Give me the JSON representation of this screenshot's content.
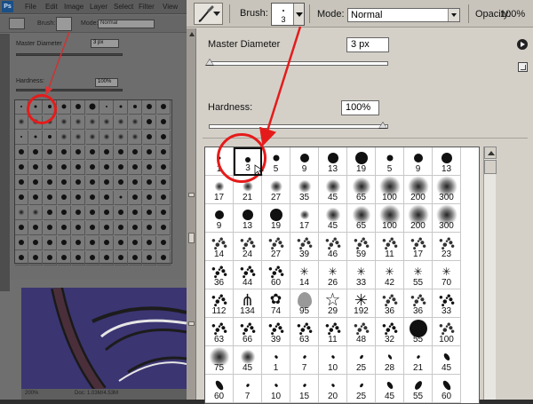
{
  "thumbnail": {
    "menu": [
      "File",
      "Edit",
      "Image",
      "Layer",
      "Select",
      "Filter",
      "View"
    ],
    "ps_logo": "Ps",
    "options": {
      "brush_label": "Brush:",
      "mode_label": "Mode:",
      "mode_value": "Normal"
    },
    "panel": {
      "diameter_label": "Master Diameter",
      "diameter_value": "3 px",
      "hardness_label": "Hardness:",
      "hardness_value": "100%"
    },
    "status": {
      "zoom": "200%",
      "doc": "Doc: 1.03M/4.53M"
    }
  },
  "toolbar": {
    "brush_label": "Brush:",
    "brush_size": "3",
    "mode_label": "Mode:",
    "mode_value": "Normal",
    "opacity_label": "Opacity:",
    "opacity_value": "100%"
  },
  "panel": {
    "diameter_label": "Master Diameter",
    "diameter_value": "3 px",
    "hardness_label": "Hardness:",
    "hardness_value": "100%"
  },
  "colors": {
    "highlight": "#e51b1b",
    "panel_bg": "#d4d0c8"
  },
  "brush_rows": [
    [
      "1",
      "3",
      "5",
      "9",
      "13",
      "19",
      "5",
      "9",
      "13"
    ],
    [
      "17",
      "21",
      "27",
      "35",
      "45",
      "65",
      "100",
      "200",
      "300"
    ],
    [
      "9",
      "13",
      "19",
      "17",
      "45",
      "65",
      "100",
      "200",
      "300"
    ],
    [
      "14",
      "24",
      "27",
      "39",
      "46",
      "59",
      "11",
      "17",
      "23"
    ],
    [
      "36",
      "44",
      "60",
      "14",
      "26",
      "33",
      "42",
      "55",
      "70"
    ],
    [
      "112",
      "134",
      "74",
      "95",
      "29",
      "192",
      "36",
      "36",
      "33"
    ],
    [
      "63",
      "66",
      "39",
      "63",
      "11",
      "48",
      "32",
      "55",
      "100"
    ],
    [
      "75",
      "45",
      "1",
      "7",
      "10",
      "25",
      "28",
      "21",
      "45"
    ],
    [
      "60",
      "7",
      "10",
      "15",
      "20",
      "25",
      "45",
      "55",
      "60"
    ]
  ],
  "brush_types": [
    [
      "hard",
      "hard",
      "hard",
      "hard",
      "hard",
      "hard",
      "hard",
      "hard",
      "hard"
    ],
    [
      "soft",
      "soft",
      "soft",
      "soft",
      "soft",
      "soft",
      "soft",
      "soft",
      "soft"
    ],
    [
      "hard",
      "hard",
      "hard",
      "soft",
      "soft",
      "soft",
      "soft",
      "soft",
      "soft"
    ],
    [
      "spatter",
      "spatter",
      "spatter",
      "spatter",
      "spatter",
      "spatter",
      "spatter",
      "spatter",
      "spatter"
    ],
    [
      "chalk",
      "chalk",
      "chalk",
      "star",
      "star",
      "star",
      "star",
      "star",
      "star"
    ],
    [
      "dune",
      "grass",
      "leaf",
      "leaf-gray",
      "star-outline",
      "burst",
      "spatter",
      "spatter",
      "chalk"
    ],
    [
      "chalk",
      "chalk",
      "chalk",
      "chalk",
      "dune",
      "spatter",
      "chalk",
      "hard",
      "spatter"
    ],
    [
      "soft",
      "soft",
      "stroke",
      "stroke",
      "stroke",
      "stroke",
      "stroke",
      "stroke",
      "stroke"
    ],
    [
      "stroke",
      "stroke",
      "stroke",
      "stroke",
      "stroke",
      "stroke",
      "stroke",
      "stroke",
      "stroke"
    ]
  ],
  "selected": {
    "row": 0,
    "col": 1
  }
}
